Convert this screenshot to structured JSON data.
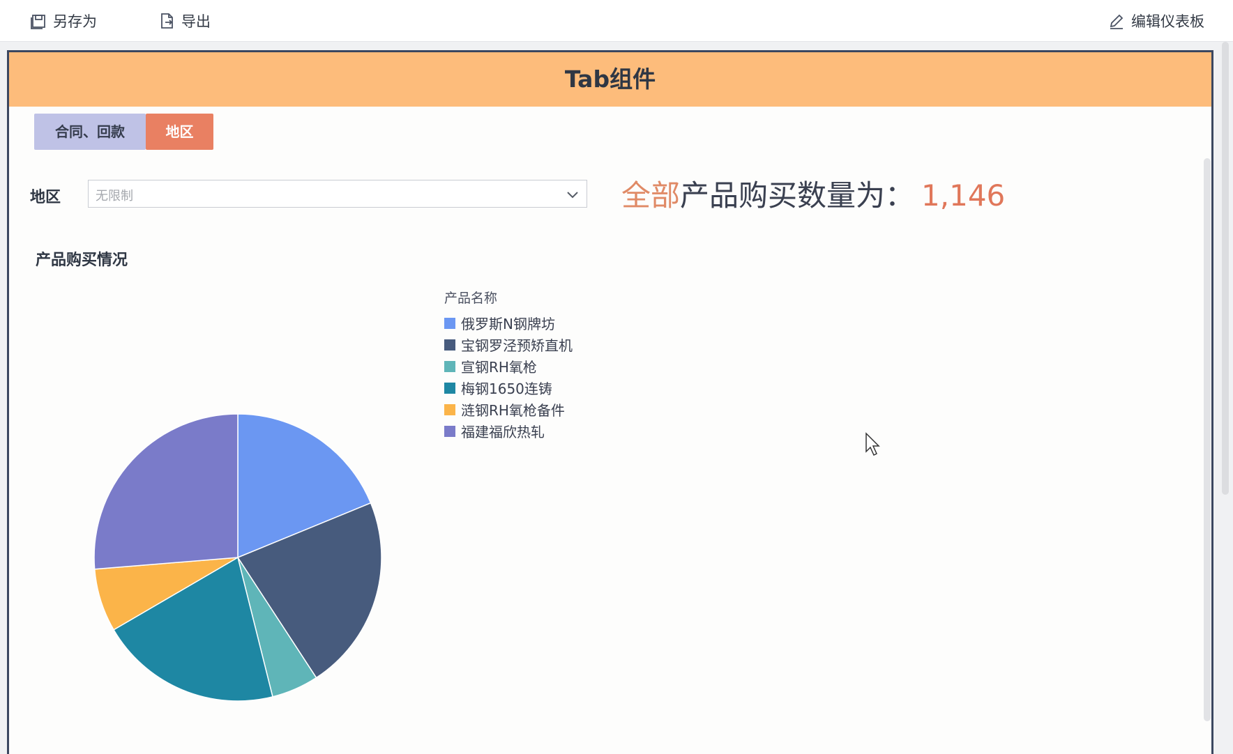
{
  "toolbar": {
    "save_as_label": "另存为",
    "export_label": "导出",
    "edit_dashboard_label": "编辑仪表板"
  },
  "dashboard": {
    "header_title": "Tab组件",
    "tabs": [
      {
        "label": "合同、回款",
        "active": false
      },
      {
        "label": "地区",
        "active": true
      }
    ],
    "filter": {
      "label": "地区",
      "placeholder": "无限制"
    },
    "kpi": {
      "highlight": "全部",
      "text": "产品购买数量为：",
      "value": "1,146"
    }
  },
  "chart_data": {
    "type": "pie",
    "title": "产品购买情况",
    "legend_title": "产品名称",
    "legend_position": "right",
    "slices": [
      {
        "name": "俄罗斯N钢牌坊",
        "value": 18.8,
        "color": "#6b97f2"
      },
      {
        "name": "宝钢罗泾预矫直机",
        "value": 22.0,
        "color": "#475b7d"
      },
      {
        "name": "宣钢RH氧枪",
        "value": 5.3,
        "color": "#5fb5b8"
      },
      {
        "name": "梅钢1650连铸",
        "value": 20.5,
        "color": "#1e87a3"
      },
      {
        "name": "涟钢RH氧枪备件",
        "value": 7.1,
        "color": "#fbb449"
      },
      {
        "name": "福建福欣热轧",
        "value": 26.3,
        "color": "#7a7bc9"
      }
    ]
  }
}
